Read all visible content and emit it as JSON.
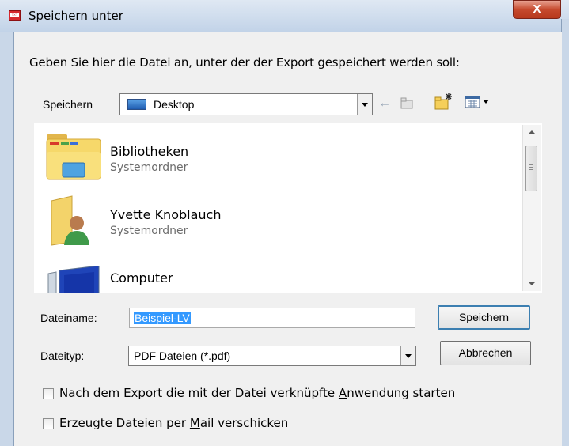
{
  "window": {
    "title": "Speichern unter",
    "close_label": "X"
  },
  "dialog": {
    "instruction": "Geben Sie hier die Datei an, unter der der Export gespeichert werden soll:",
    "save_in_label": "Speichern",
    "save_in_value": "Desktop",
    "toolbar_icons": [
      "back-arrow-icon",
      "up-folder-icon",
      "new-folder-icon",
      "view-menu-icon"
    ],
    "files": [
      {
        "name": "Bibliotheken",
        "type": "Systemordner",
        "icon": "libraries-folder-icon"
      },
      {
        "name": "Yvette Knoblauch",
        "type": "Systemordner",
        "icon": "user-folder-icon"
      },
      {
        "name": "Computer",
        "type": "",
        "icon": "computer-icon"
      }
    ],
    "filename_label": "Dateiname:",
    "filename_value": "Beispiel-LV",
    "filetype_label": "Dateityp:",
    "filetype_value": "PDF Dateien (*.pdf)",
    "save_button": "Speichern",
    "cancel_button": "Abbrechen",
    "option1_pre": "Nach dem Export die mit der Datei verknüpfte ",
    "option1_accel": "A",
    "option1_post": "nwendung starten",
    "option2_pre": "Erzeugte Dateien per ",
    "option2_accel": "M",
    "option2_post": "ail verschicken"
  }
}
